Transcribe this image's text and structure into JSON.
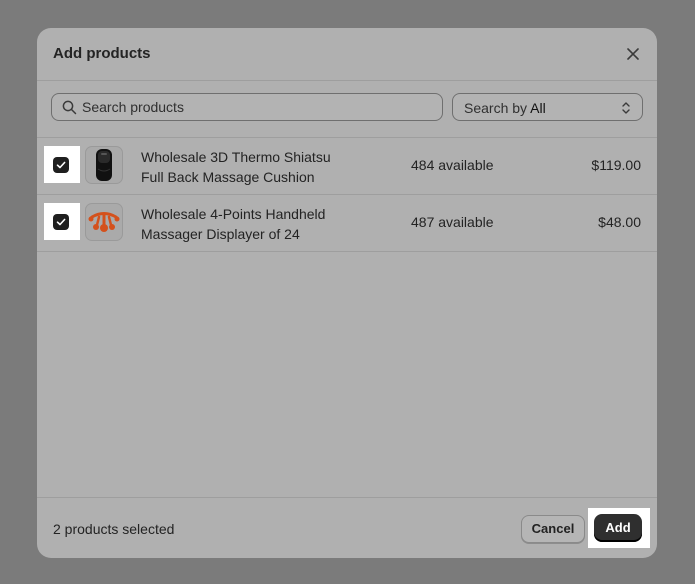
{
  "modal": {
    "title": "Add products"
  },
  "search": {
    "placeholder": "Search products",
    "by_label": "Search by",
    "by_value": "All"
  },
  "products": [
    {
      "name_line1": "Wholesale 3D Thermo Shiatsu",
      "name_line2": "Full Back Massage Cushion",
      "availability": "484 available",
      "price": "$119.00",
      "checked": true
    },
    {
      "name_line1": "Wholesale 4-Points Handheld",
      "name_line2": "Massager Displayer of 24",
      "availability": "487 available",
      "price": "$48.00",
      "checked": true
    }
  ],
  "footer": {
    "selected_count": "2 products selected",
    "cancel_label": "Cancel",
    "add_label": "Add"
  },
  "colors": {
    "overlay": "#7b7b7b",
    "modal_bg": "#b0b0b0",
    "primary_button": "#2f2f2f",
    "checkbox": "#1f1f1f",
    "product_accent": "#d4511c"
  }
}
